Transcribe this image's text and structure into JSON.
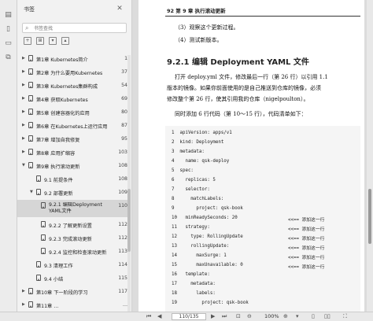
{
  "sidebar": {
    "title": "书签",
    "search_placeholder": "书签查找",
    "toc": [
      {
        "label": "第1章 Kubernetes简介",
        "page": "1",
        "level": 0,
        "expandable": true
      },
      {
        "label": "第2章 为什么要用Kubernetes",
        "page": "37",
        "level": 0,
        "expandable": true
      },
      {
        "label": "第3章 Kubernetes集群构成",
        "page": "54",
        "level": 0,
        "expandable": true
      },
      {
        "label": "第4章 获取Kubernetes",
        "page": "69",
        "level": 0,
        "expandable": true
      },
      {
        "label": "第5章 创建容器化的应用",
        "page": "80",
        "level": 0,
        "expandable": true
      },
      {
        "label": "第6章 在Kubernetes上运行应用",
        "page": "87",
        "level": 0,
        "expandable": true
      },
      {
        "label": "第7章 增加自我修复",
        "page": "95",
        "level": 0,
        "expandable": true
      },
      {
        "label": "第8章 应用扩缩容",
        "page": "103",
        "level": 0,
        "expandable": true
      },
      {
        "label": "第9章 执行滚动更新",
        "page": "108",
        "level": 0,
        "expandable": true
      },
      {
        "label": "9.1 前提条件",
        "page": "108",
        "level": 1,
        "expandable": false
      },
      {
        "label": "9.2 部署更新",
        "page": "109",
        "level": 1,
        "expandable": true
      },
      {
        "label": "9.2.1 编辑Deployment YAML文件",
        "page": "110",
        "level": 2,
        "expandable": false
      },
      {
        "label": "9.2.2 了解更新设置",
        "page": "112",
        "level": 2,
        "expandable": false
      },
      {
        "label": "9.2.3 完成滚动更新",
        "page": "112",
        "level": 2,
        "expandable": false
      },
      {
        "label": "9.2.4 监控和检查滚动更新",
        "page": "113",
        "level": 2,
        "expandable": false
      },
      {
        "label": "9.3 清理工作",
        "page": "114",
        "level": 1,
        "expandable": false
      },
      {
        "label": "9.4 小结",
        "page": "115",
        "level": 1,
        "expandable": false
      },
      {
        "label": "第10章 下一阶段的学习",
        "page": "117",
        "level": 0,
        "expandable": true
      },
      {
        "label": "第11章 …",
        "page": "…",
        "level": 0,
        "expandable": true
      }
    ]
  },
  "document": {
    "running_head": "92   第 9 章   执行滚动更新",
    "list_items": [
      "（3）观察这个更新过程。",
      "（4）测试新版本。"
    ],
    "section_heading": "9.2.1   编辑 Deployment YAML 文件",
    "para1": [
      "打开 deploy.yml 文件，修改最后一行（第 26 行）以引用 1.1",
      "版本的镜像。如果你前面使用的是自己推送到仓库的镜像，必须",
      "修改整个第 26 行，使其引用我的仓库（nigelpoulton）。"
    ],
    "para2": "同时添加 6 行代码（第 10～15 行），代码清单如下：",
    "code_lines": [
      "1  apiVersion: apps/v1",
      "2  kind: Deployment",
      "3  metadata:",
      "4    name: qsk-deploy",
      "5  spec:",
      "6    replicas: 5",
      "7    selector:",
      "8      matchLabels:",
      "9        project: qsk-book",
      "10   minReadySeconds: 20",
      "11   strategy:",
      "12     type: RollingUpdate",
      "13     rollingUpdate:",
      "14       maxSurge: 1",
      "15       maxUnavailable: 0",
      "16   template:",
      "17     metadata:",
      "18       labels:",
      "19         project: qsk-book"
    ],
    "code_comments": [
      {
        "line": 10,
        "text": "<<== 添加这一行"
      },
      {
        "line": 11,
        "text": "<<== 添加这一行"
      },
      {
        "line": 12,
        "text": "<<== 添加这一行"
      },
      {
        "line": 13,
        "text": "<<== 添加这一行"
      },
      {
        "line": 14,
        "text": "<<== 添加这一行"
      },
      {
        "line": 15,
        "text": "<<== 添加这一行"
      }
    ]
  },
  "statusbar": {
    "page_indicator": "110/135",
    "zoom": "100%"
  },
  "icons": {
    "strip": [
      "thumbnail-icon",
      "bookmark-icon",
      "comment-icon",
      "attachment-icon"
    ]
  }
}
